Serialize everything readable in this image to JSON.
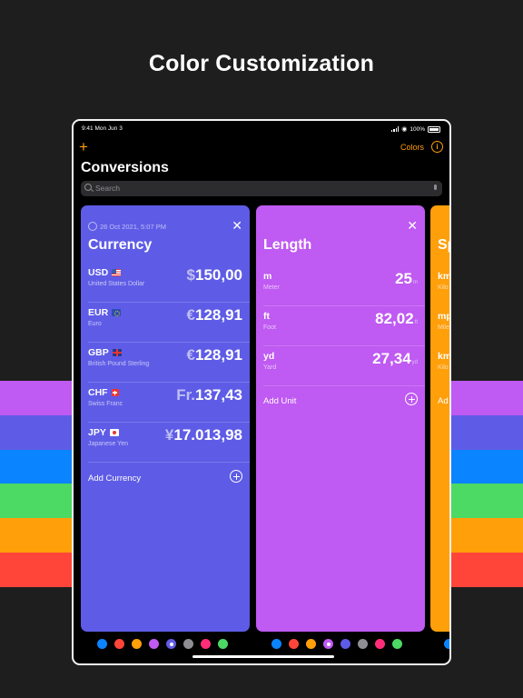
{
  "headline": "Color Customization",
  "stripes": [
    "#bf5af2",
    "#5e5ce6",
    "#0a84ff",
    "#4cd964",
    "#ff9f0a",
    "#ff453a"
  ],
  "status": {
    "time": "9:41 Mon Jun 3",
    "battery": "100%"
  },
  "nav": {
    "colors_label": "Colors",
    "title": "Conversions"
  },
  "search": {
    "placeholder": "Search"
  },
  "cards": {
    "currency": {
      "date": "26 Oct 2021, 5:07 PM",
      "title": "Currency",
      "color": "#5e5ce6",
      "rows": [
        {
          "code": "USD",
          "flag": "flag-us",
          "name": "United States Dollar",
          "symbol": "$",
          "value": "150,00"
        },
        {
          "code": "EUR",
          "flag": "flag-eu",
          "name": "Euro",
          "symbol": "€",
          "value": "128,91"
        },
        {
          "code": "GBP",
          "flag": "flag-gb",
          "name": "British Pound Sterling",
          "symbol": "€",
          "value": "128,91"
        },
        {
          "code": "CHF",
          "flag": "flag-ch",
          "name": "Swiss Franc",
          "symbol": "Fr.",
          "value": "137,43"
        },
        {
          "code": "JPY",
          "flag": "flag-jp",
          "name": "Japanese Yen",
          "symbol": "¥",
          "value": "17.013,98"
        }
      ],
      "add_label": "Add Currency"
    },
    "length": {
      "title": "Length",
      "color": "#bf5af2",
      "rows": [
        {
          "code": "m",
          "name": "Meter",
          "value": "25",
          "unit": "m"
        },
        {
          "code": "ft",
          "name": "Foot",
          "value": "82,02",
          "unit": "ft"
        },
        {
          "code": "yd",
          "name": "Yard",
          "value": "27,34",
          "unit": "yd"
        }
      ],
      "add_label": "Add Unit"
    },
    "speed": {
      "title": "Sp",
      "color": "#ff9f0a",
      "rows": [
        {
          "code": "km",
          "name": "Kilo"
        },
        {
          "code": "mp",
          "name": "Mile"
        },
        {
          "code": "km",
          "name": "Kilo"
        }
      ],
      "add_label": "Ad"
    }
  },
  "palette": [
    "#0a84ff",
    "#ff453a",
    "#ff9f0a",
    "#bf5af2",
    "#5e5ce6",
    "#8e8e93",
    "#ff2d78",
    "#4cd964"
  ],
  "palette_selected": {
    "currency": 4,
    "length": 3
  }
}
